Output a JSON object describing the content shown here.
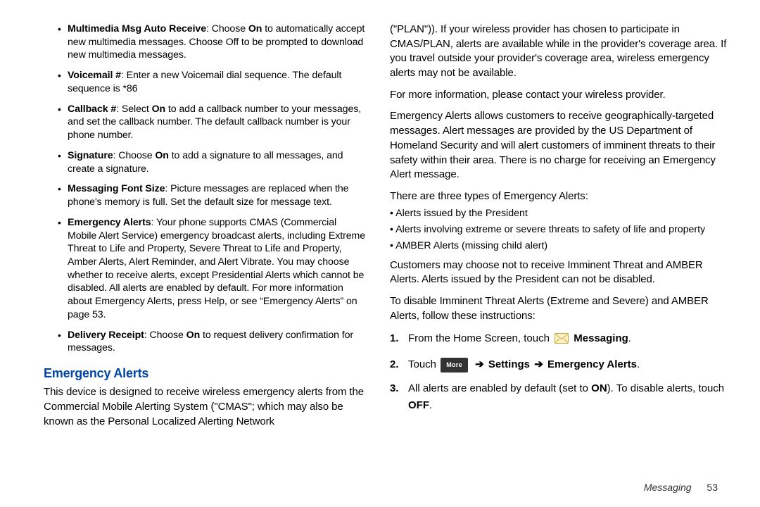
{
  "left": {
    "bullets": [
      {
        "label": "Multimedia Msg Auto Receive",
        "text": ": Choose ",
        "bold1": "On",
        "rest": " to automatically accept new multimedia messages. Choose Off to be prompted to download new multimedia messages."
      },
      {
        "label": "Voicemail #",
        "text": ": Enter a new Voicemail dial sequence. The default sequence is *86"
      },
      {
        "label": "Callback #",
        "text": ": Select ",
        "bold1": "On",
        "rest": " to add a callback number to your messages, and set the callback number. The default callback number is your phone number."
      },
      {
        "label": "Signature",
        "text": ": Choose ",
        "bold1": "On",
        "rest": " to add a signature to all messages, and create a signature."
      },
      {
        "label": "Messaging Font Size",
        "text": ": Picture messages are replaced when the phone's memory is full. Set the default size for message text."
      },
      {
        "label": "Emergency Alerts",
        "text": ": Your phone supports CMAS (Commercial Mobile Alert Service) emergency broadcast alerts, including Extreme Threat to Life and Property, Severe Threat to Life and Property, Amber Alerts, Alert Reminder, and Alert Vibrate. You may choose whether to receive alerts, except Presidential Alerts which cannot be disabled. All alerts are enabled by default. For more information about Emergency Alerts, press Help, or see “Emergency Alerts” on page 53."
      },
      {
        "label": "Delivery Receipt",
        "text": ": Choose ",
        "bold1": "On",
        "rest": " to request delivery confirmation for messages."
      }
    ],
    "section_title": "Emergency Alerts",
    "section_para": "This device is designed to receive wireless emergency alerts from the Commercial Mobile Alerting System (\"CMAS\"; which may also be known as the Personal Localized Alerting Network"
  },
  "right": {
    "p1": "(\"PLAN\")). If your wireless provider has chosen to participate in CMAS/PLAN, alerts are available while in the provider's coverage area. If you travel outside your provider's coverage area, wireless emergency alerts may not be available.",
    "p2": "For more information, please contact your wireless provider.",
    "p3": "Emergency Alerts allows customers to receive geographically-targeted messages. Alert messages are provided by the US Department of Homeland Security and will alert customers of imminent threats to their safety within their area. There is no charge for receiving an Emergency Alert message.",
    "p4": "There are three types of Emergency Alerts:",
    "types": [
      "• Alerts issued by the President",
      "• Alerts involving extreme or severe threats to safety of life and property",
      "• AMBER Alerts (missing child alert)"
    ],
    "p5": "Customers may choose not to receive Imminent Threat and AMBER Alerts. Alerts issued by the President can not be disabled.",
    "p6": "To disable Imminent Threat Alerts (Extreme and Severe) and AMBER Alerts, follow these instructions:",
    "steps": {
      "s1_pre": "From the Home Screen, touch ",
      "s1_bold": "Messaging",
      "s2_touch": "Touch ",
      "s2_more": "More",
      "s2_settings": "Settings",
      "s2_ea": "Emergency Alerts",
      "s3_a": "All alerts are enabled by default (set to ",
      "s3_on": "ON",
      "s3_b": "). To disable alerts, touch ",
      "s3_off": "OFF",
      "s3_c": "."
    }
  },
  "footer": {
    "section": "Messaging",
    "page": "53"
  }
}
